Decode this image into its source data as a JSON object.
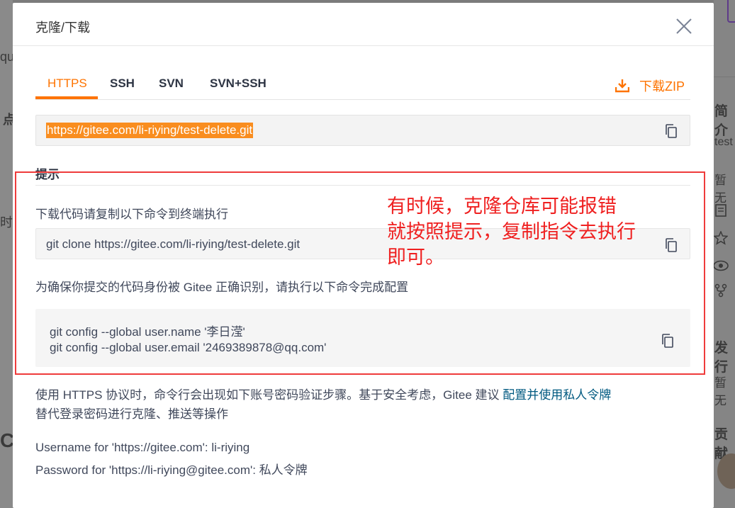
{
  "background": {
    "left_fragments": [
      "qu",
      "点",
      "时",
      "C"
    ],
    "right_fragments": [
      "简介",
      "test",
      "暂无",
      "发行",
      "暂无",
      "贡献"
    ]
  },
  "dialog": {
    "title": "克隆/下载",
    "tabs": [
      {
        "label": "HTTPS",
        "active": true
      },
      {
        "label": "SSH",
        "active": false
      },
      {
        "label": "SVN",
        "active": false
      },
      {
        "label": "SVN+SSH",
        "active": false
      }
    ],
    "download_zip_label": "下载ZIP",
    "clone_url": "https://gitee.com/li-riying/test-delete.git",
    "tip": {
      "title": "提示",
      "line1": "下载代码请复制以下命令到终端执行",
      "clone_command": "git clone https://gitee.com/li-riying/test-delete.git",
      "line2": "为确保你提交的代码身份被 Gitee 正确识别，请执行以下命令完成配置",
      "config_name": "git config --global user.name '李日滢'",
      "config_email": "git config --global user.email '2469389878@qq.com'"
    },
    "note": {
      "prefix": "使用 HTTPS 协议时，命令行会出现如下账号密码验证步骤。基于安全考虑，Gitee 建议",
      "link": "配置并使用私人令牌",
      "suffix": "替代登录密码进行克隆、推送等操作"
    },
    "credentials": {
      "username_line": "Username for 'https://gitee.com': li-riying",
      "password_line": "Password for 'https://li-riying@gitee.com': 私人令牌"
    }
  },
  "annotation": {
    "line1": "有时候，克隆仓库可能报错",
    "line2": "就按照提示，复制指令去执行",
    "line3": "即可。"
  },
  "colors": {
    "accent": "#fe7300",
    "link": "#005980",
    "annotation": "#ef2020",
    "overlay": "#7b7b7b"
  }
}
